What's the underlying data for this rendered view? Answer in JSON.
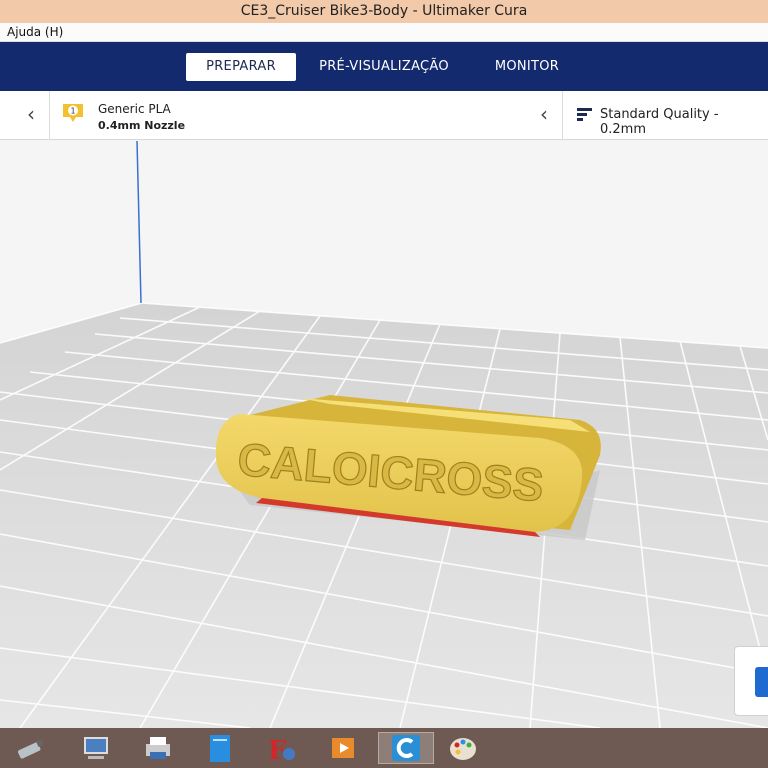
{
  "window": {
    "title": "CE3_Cruiser Bike3-Body - Ultimaker Cura"
  },
  "menu": {
    "items": [
      "Ajuda (H)"
    ]
  },
  "stages": [
    {
      "label": "PREPARAR",
      "active": true
    },
    {
      "label": "PRÉ-VISUALIZAÇÃO",
      "active": false
    },
    {
      "label": "MONITOR",
      "active": false
    }
  ],
  "printer": {
    "extruder_number": "1",
    "material": "Generic PLA",
    "nozzle": "0.4mm Nozzle",
    "quality": "Standard Quality - 0.2mm"
  },
  "model": {
    "embossed_text": "CALOICROSS",
    "color": "#f0d35a"
  },
  "colors": {
    "header": "#142a6e",
    "accent": "#1f6ad1",
    "model": "#f0d35a",
    "taskbar": "#6e5a52"
  },
  "taskbar": {
    "icons": [
      "usb-drive-icon",
      "network-computer-icon",
      "printer-config-icon",
      "blue-document-icon",
      "font-settings-icon",
      "media-player-icon",
      "cura-icon",
      "paint-icon"
    ],
    "active_icon": "cura-icon"
  }
}
